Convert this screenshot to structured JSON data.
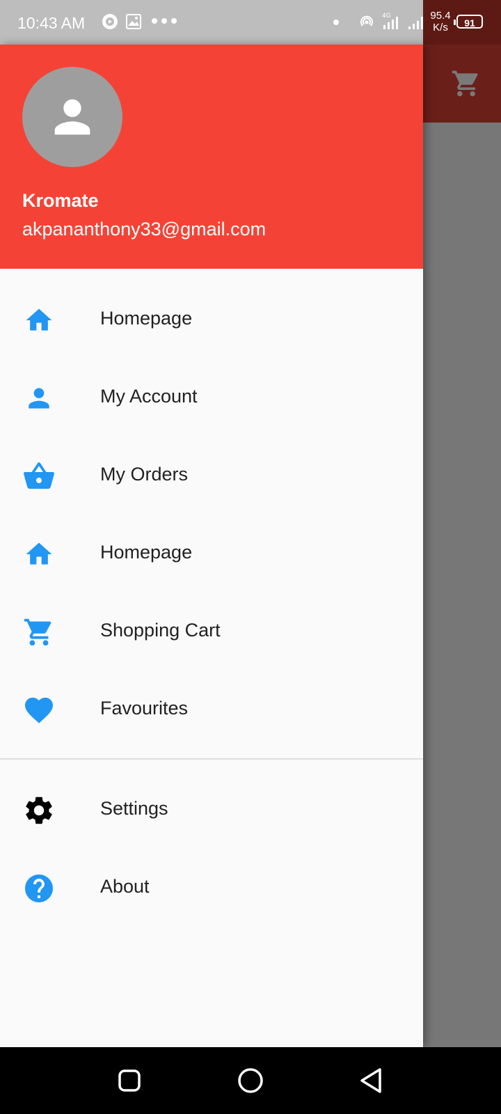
{
  "status_bar": {
    "time": "10:43 AM",
    "network_speed_value": "95.4",
    "network_speed_unit": "K/s",
    "battery_level": "91",
    "network_type": "4G"
  },
  "drawer": {
    "account_name": "Kromate",
    "account_email": "akpananthony33@gmail.com",
    "items": [
      {
        "label": "Homepage",
        "icon": "home-icon"
      },
      {
        "label": "My Account",
        "icon": "person-icon"
      },
      {
        "label": "My Orders",
        "icon": "basket-icon"
      },
      {
        "label": "Homepage",
        "icon": "home-icon"
      },
      {
        "label": "Shopping Cart",
        "icon": "cart-icon"
      },
      {
        "label": "Favourites",
        "icon": "heart-icon"
      }
    ],
    "secondary_items": [
      {
        "label": "Settings",
        "icon": "gear-icon"
      },
      {
        "label": "About",
        "icon": "help-icon"
      }
    ]
  },
  "colors": {
    "header_bg": "#f44336",
    "icon_accent": "#2196f3",
    "drawer_bg": "#fafafa",
    "scrim": "#777777"
  },
  "background_app": {
    "appbar_icon": "cart-icon"
  },
  "navigation_bar": {
    "buttons": [
      "recents-button",
      "home-button",
      "back-button"
    ]
  }
}
